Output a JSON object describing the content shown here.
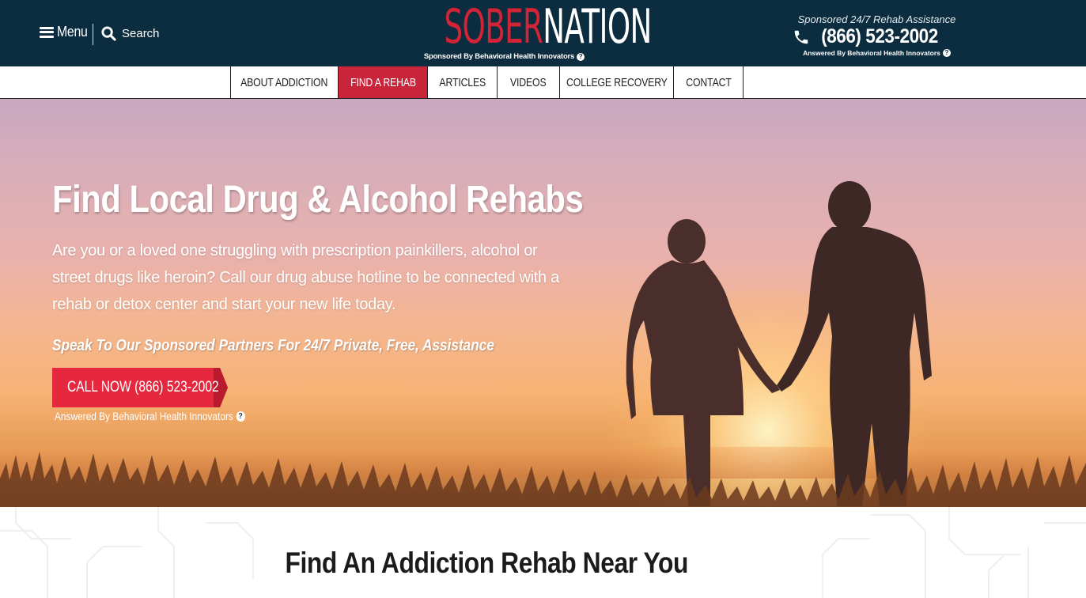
{
  "header": {
    "menu_label": "Menu",
    "search_label": "Search",
    "logo_part1": "SOBER",
    "logo_part2": "NATION",
    "logo_sponsor": "Sponsored By Behavioral Health Innovators",
    "sponsor_line": "Sponsored 24/7 Rehab Assistance",
    "phone": "(866) 523-2002",
    "answered": "Answered By Behavioral Health Innovators"
  },
  "nav": {
    "items": [
      {
        "label": "ABOUT ADDICTION"
      },
      {
        "label": "FIND A REHAB"
      },
      {
        "label": "ARTICLES"
      },
      {
        "label": "VIDEOS"
      },
      {
        "label": "COLLEGE RECOVERY"
      },
      {
        "label": "CONTACT"
      }
    ],
    "active": "FIND A REHAB"
  },
  "hero": {
    "title": "Find Local Drug & Alcohol Rehabs",
    "text": "Are you or a loved one struggling with prescription painkillers, alcohol or street drugs like heroin? Call our drug abuse hotline to be connected with a rehab or detox center and start your new life today.",
    "partner_line": "Speak To Our Sponsored Partners For 24/7 Private, Free, Assistance",
    "cta_label": "CALL NOW (866) 523-2002",
    "cta_answered": "Answered By Behavioral Health Innovators"
  },
  "section": {
    "title": "Find An Addiction Rehab Near You"
  },
  "colors": {
    "header_bg": "#0c2d3f",
    "brand_red": "#d32336",
    "nav_active": "#c8243a",
    "cta_red": "#e6283f"
  },
  "icons": {
    "menu": "hamburger-icon",
    "search": "search-icon",
    "phone": "phone-icon",
    "help": "question-circle-icon"
  }
}
